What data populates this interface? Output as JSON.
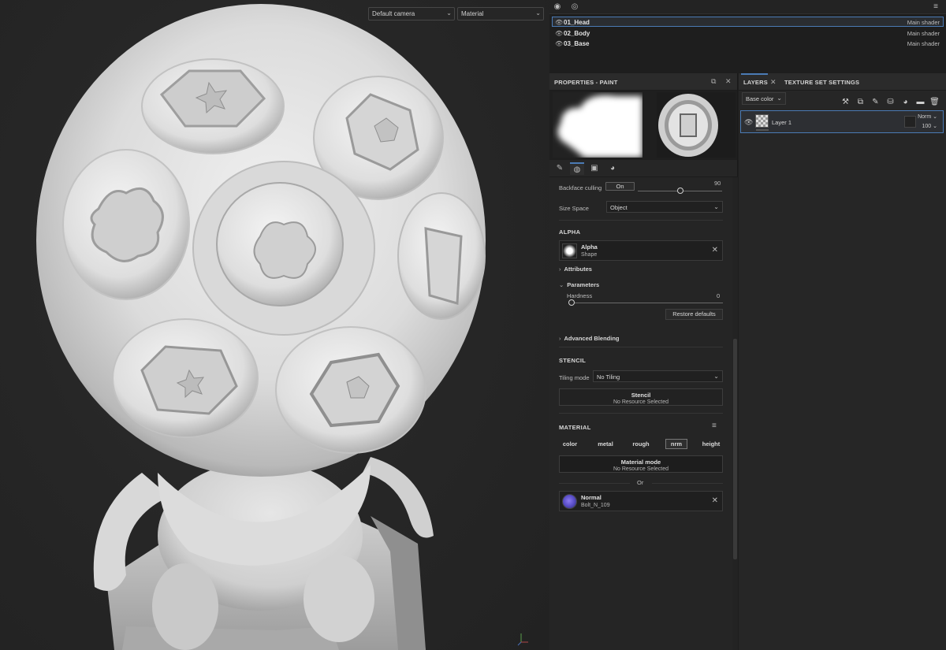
{
  "viewport": {
    "camera_select": "Default camera",
    "render_mode_select": "Material"
  },
  "texture_sets": [
    {
      "name": "01_Head",
      "shader": "Main shader",
      "selected": true
    },
    {
      "name": "02_Body",
      "shader": "Main shader",
      "selected": false
    },
    {
      "name": "03_Base",
      "shader": "Main shader",
      "selected": false
    }
  ],
  "properties": {
    "title": "PROPERTIES - PAINT",
    "backface_culling_label": "Backface culling",
    "backface_culling_value": "On",
    "backface_slider_value": "90",
    "size_space_label": "Size Space",
    "size_space_value": "Object",
    "alpha": {
      "section": "ALPHA",
      "resource_name": "Alpha",
      "resource_type": "Shape",
      "attributes": "Attributes",
      "parameters": "Parameters",
      "hardness_label": "Hardness",
      "hardness_value": "0",
      "restore_defaults": "Restore defaults",
      "advanced_blending": "Advanced Blending"
    },
    "stencil": {
      "section": "STENCIL",
      "tiling_label": "Tiling mode",
      "tiling_value": "No Tiling",
      "block_title": "Stencil",
      "block_sub": "No Resource Selected"
    },
    "material": {
      "section": "MATERIAL",
      "channels": [
        "color",
        "metal",
        "rough",
        "nrm",
        "height"
      ],
      "active_channel": "nrm",
      "mode_title": "Material mode",
      "mode_sub": "No Resource Selected",
      "or_label": "Or",
      "resource_name": "Normal",
      "resource_file": "Bolt_N_109"
    }
  },
  "layers": {
    "tab_layers": "LAYERS",
    "tab_texture_set_settings": "TEXTURE SET SETTINGS",
    "channel_select": "Base color",
    "items": [
      {
        "name": "Layer 1",
        "blend_mode": "Norm",
        "opacity": "100"
      }
    ]
  },
  "colors": {
    "accent": "#4b7bb5",
    "panel": "#252525",
    "viewport_bg": "#282828"
  }
}
